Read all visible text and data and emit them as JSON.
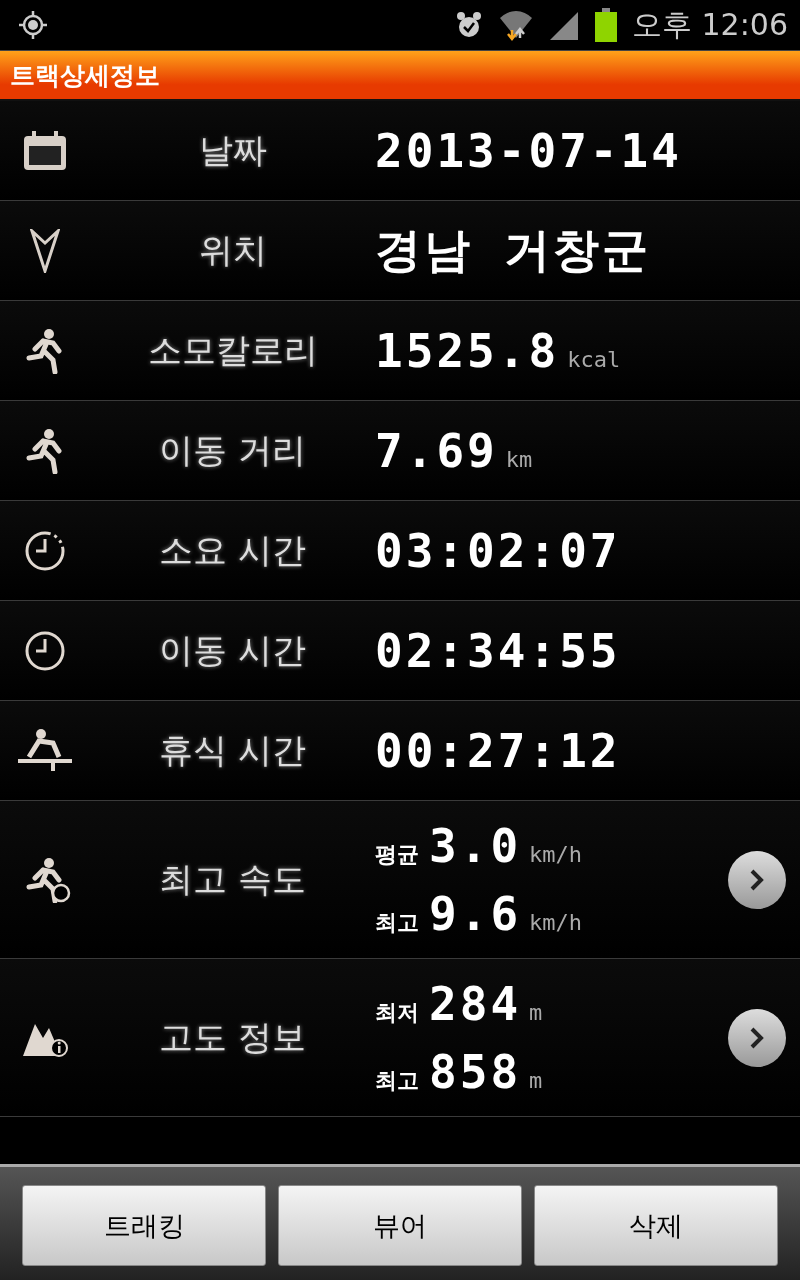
{
  "status_bar": {
    "time": "오후 12:06"
  },
  "title_bar": {
    "title": "트랙상세정보"
  },
  "rows": [
    {
      "kind": "single",
      "label": "날짜",
      "value": "2013-07-14"
    },
    {
      "kind": "single",
      "label": "위치",
      "value": "경남 거창군"
    },
    {
      "kind": "single",
      "label": "소모칼로리",
      "value": "1525.8",
      "unit": "kcal"
    },
    {
      "kind": "single",
      "label": "이동 거리",
      "value": "7.69",
      "unit": "km"
    },
    {
      "kind": "single",
      "label": "소요 시간",
      "value": "03:02:07"
    },
    {
      "kind": "single",
      "label": "이동 시간",
      "value": "02:34:55"
    },
    {
      "kind": "single",
      "label": "휴식 시간",
      "value": "00:27:12"
    },
    {
      "kind": "split",
      "label": "최고 속도",
      "entries": [
        {
          "prefix": "평균",
          "value": "3.0",
          "unit": "km/h"
        },
        {
          "prefix": "최고",
          "value": "9.6",
          "unit": "km/h"
        }
      ]
    },
    {
      "kind": "split",
      "label": "고도 정보",
      "entries": [
        {
          "prefix": "최저",
          "value": "284",
          "unit": "m"
        },
        {
          "prefix": "최고",
          "value": "858",
          "unit": "m"
        }
      ]
    }
  ],
  "buttons": [
    "트래킹",
    "뷰어",
    "삭제"
  ]
}
